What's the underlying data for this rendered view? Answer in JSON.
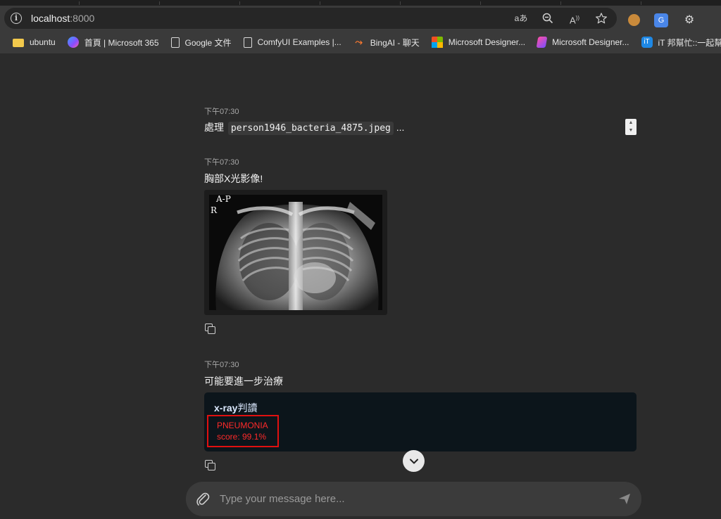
{
  "browser": {
    "url_host": "localhost",
    "url_port": ":8000",
    "omni_icons": [
      "read-aloud-translate-icon",
      "zoom-icon",
      "read-aloud-icon",
      "favorite-star-icon"
    ],
    "extensions": [
      "cookie-extension-icon",
      "google-translate-icon",
      "extensions-puzzle-icon"
    ]
  },
  "bookmarks": [
    {
      "label": "ubuntu",
      "icon": "folder-icon"
    },
    {
      "label": "首頁 | Microsoft 365",
      "icon": "microsoft365-icon"
    },
    {
      "label": "Google 文件",
      "icon": "page-icon"
    },
    {
      "label": "ComfyUI Examples |...",
      "icon": "page-icon"
    },
    {
      "label": "BingAI - 聊天",
      "icon": "bing-icon"
    },
    {
      "label": "Microsoft Designer...",
      "icon": "microsoft-icon"
    },
    {
      "label": "Microsoft Designer...",
      "icon": "designer-icon"
    },
    {
      "label": "iT 邦幫忙::一起幫忙...",
      "icon": "ithome-icon"
    }
  ],
  "chat": {
    "messages": [
      {
        "time": "下午07:30",
        "prefix": "處理",
        "filename": "person1946_bacteria_4875.jpeg",
        "suffix": "..."
      },
      {
        "time": "下午07:30",
        "text": "胸部X光影像!",
        "image_labels": [
          "A-P",
          "R"
        ]
      },
      {
        "time": "下午07:30",
        "text": "可能要進一步治療"
      }
    ],
    "result": {
      "title_prefix": "x-ray",
      "title_suffix": "判讀",
      "label": "PNEUMONIA",
      "score": "score: 99.1%"
    }
  },
  "composer": {
    "placeholder": "Type your message here..."
  }
}
